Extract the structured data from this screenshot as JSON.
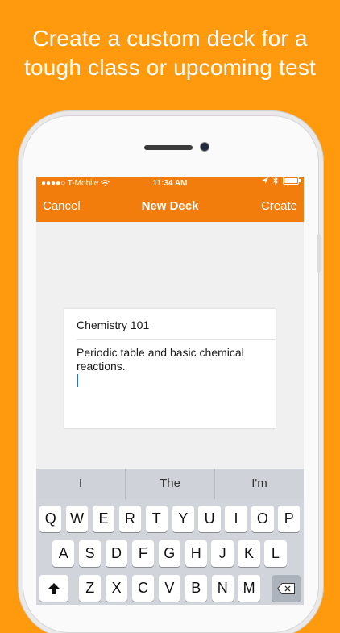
{
  "headline": {
    "line1": "Create a custom deck for a",
    "line2": "tough class or upcoming test"
  },
  "status_bar": {
    "carrier": "●●●●○ T-Mobile",
    "wifi_icon": "wifi-icon",
    "time": "11:34 AM",
    "location_icon": "location-arrow-icon",
    "bluetooth_icon": "bluetooth-icon",
    "battery_icon": "battery-icon"
  },
  "navbar": {
    "cancel_label": "Cancel",
    "title": "New Deck",
    "create_label": "Create",
    "color": "#F27D0C"
  },
  "deck_form": {
    "name_value": "Chemistry 101",
    "description_value": "Periodic table and basic chemical reactions."
  },
  "suggestions": [
    "I",
    "The",
    "I'm"
  ],
  "keyboard": {
    "row1": [
      "Q",
      "W",
      "E",
      "R",
      "T",
      "Y",
      "U",
      "I",
      "O",
      "P"
    ],
    "row2": [
      "A",
      "S",
      "D",
      "F",
      "G",
      "H",
      "J",
      "K",
      "L"
    ],
    "row3": [
      "Z",
      "X",
      "C",
      "V",
      "B",
      "N",
      "M"
    ],
    "shift_icon": "shift-arrow-icon",
    "delete_icon": "backspace-icon"
  },
  "colors": {
    "background": "#FF9A0F",
    "accent": "#F27D0C"
  }
}
